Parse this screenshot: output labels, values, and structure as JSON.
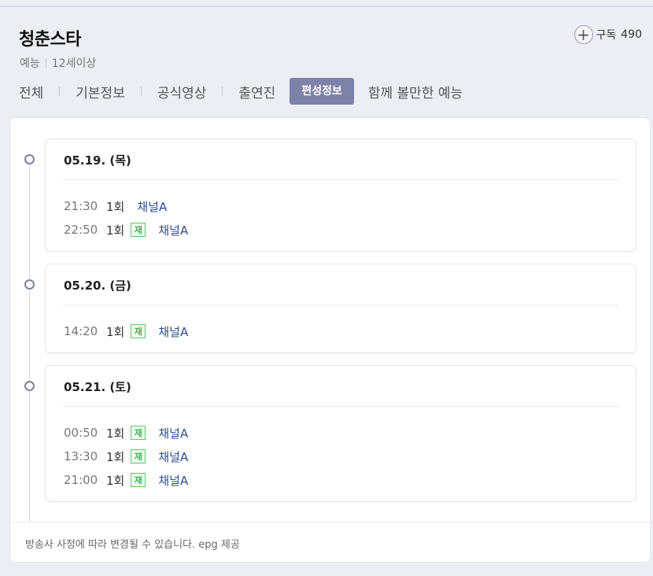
{
  "header": {
    "title": "청춘스타",
    "genre": "예능",
    "rating": "12세이상",
    "subscribe_label": "구독",
    "subscribe_count": "490"
  },
  "tabs": [
    {
      "label": "전체"
    },
    {
      "label": "기본정보"
    },
    {
      "label": "공식영상"
    },
    {
      "label": "출연진"
    },
    {
      "label": "편성정보",
      "active": true
    },
    {
      "label": "함께 볼만한 예능"
    }
  ],
  "schedule": [
    {
      "date": "05.19. (목)",
      "rows": [
        {
          "time": "21:30",
          "episode": "1회",
          "rerun": "",
          "channel": "채널A"
        },
        {
          "time": "22:50",
          "episode": "1회",
          "rerun": "재",
          "channel": "채널A"
        }
      ]
    },
    {
      "date": "05.20. (금)",
      "rows": [
        {
          "time": "14:20",
          "episode": "1회",
          "rerun": "재",
          "channel": "채널A"
        }
      ]
    },
    {
      "date": "05.21. (토)",
      "rows": [
        {
          "time": "00:50",
          "episode": "1회",
          "rerun": "재",
          "channel": "채널A"
        },
        {
          "time": "13:30",
          "episode": "1회",
          "rerun": "재",
          "channel": "채널A"
        },
        {
          "time": "21:00",
          "episode": "1회",
          "rerun": "재",
          "channel": "채널A"
        }
      ]
    }
  ],
  "footer": "방송사 사정에 따라 변경될 수 있습니다. epg 제공",
  "colors": {
    "accent_tab": "#7d82a8",
    "rerun_badge": "#3bb84c",
    "channel_link": "#2b4d8f"
  },
  "icons": {
    "subscribe": "plus-circle-icon",
    "timeline_marker": "circle-dot-icon"
  }
}
